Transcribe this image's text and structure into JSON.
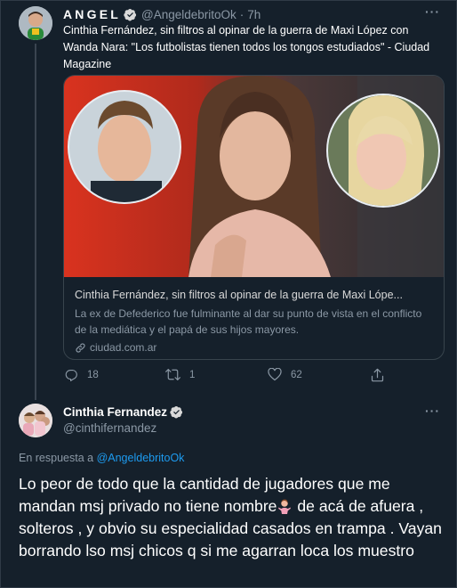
{
  "parent_tweet": {
    "author_name": "ANGEL",
    "handle": "@AngeldebritoOk",
    "separator": "·",
    "time": "7h",
    "text": "Cinthia Fernández, sin filtros al opinar de la guerra de Maxi López con Wanda Nara: \"Los futbolistas tienen todos los tongos estudiados\" - Ciudad Magazine",
    "card": {
      "title": "Cinthia Fernández, sin filtros al opinar de la guerra de Maxi Lópe...",
      "description": "La ex de Defederico fue fulminante al dar su punto de vista en el conflicto de la mediática y el papá de sus hijos mayores.",
      "domain": "ciudad.com.ar"
    },
    "actions": {
      "reply_count": "18",
      "retweet_count": "1",
      "like_count": "62"
    }
  },
  "reply_tweet": {
    "author_name": "Cinthia Fernandez",
    "handle": "@cinthifernandez",
    "reply_prefix": "En respuesta a",
    "reply_mention": "@AngeldebritoOk",
    "text_part1": "Lo peor de todo que la cantidad de jugadores que me mandan msj privado no tiene nombre",
    "text_part2": " de acá de afuera , solteros , y obvio su especialidad casados en trampa . Vayan borrando lso msj chicos q si me agarran loca los muestro"
  },
  "icons": {
    "more": "more-dots-icon",
    "verified": "verified-badge-icon",
    "reply": "reply-icon",
    "retweet": "retweet-icon",
    "like": "heart-icon",
    "share": "share-icon",
    "link": "link-icon",
    "emoji": "person-shrugging-emoji"
  },
  "colors": {
    "background": "#15202b",
    "text": "#ffffff",
    "secondary": "#8b98a5",
    "accent": "#1d9bf0",
    "border": "#38444d"
  }
}
